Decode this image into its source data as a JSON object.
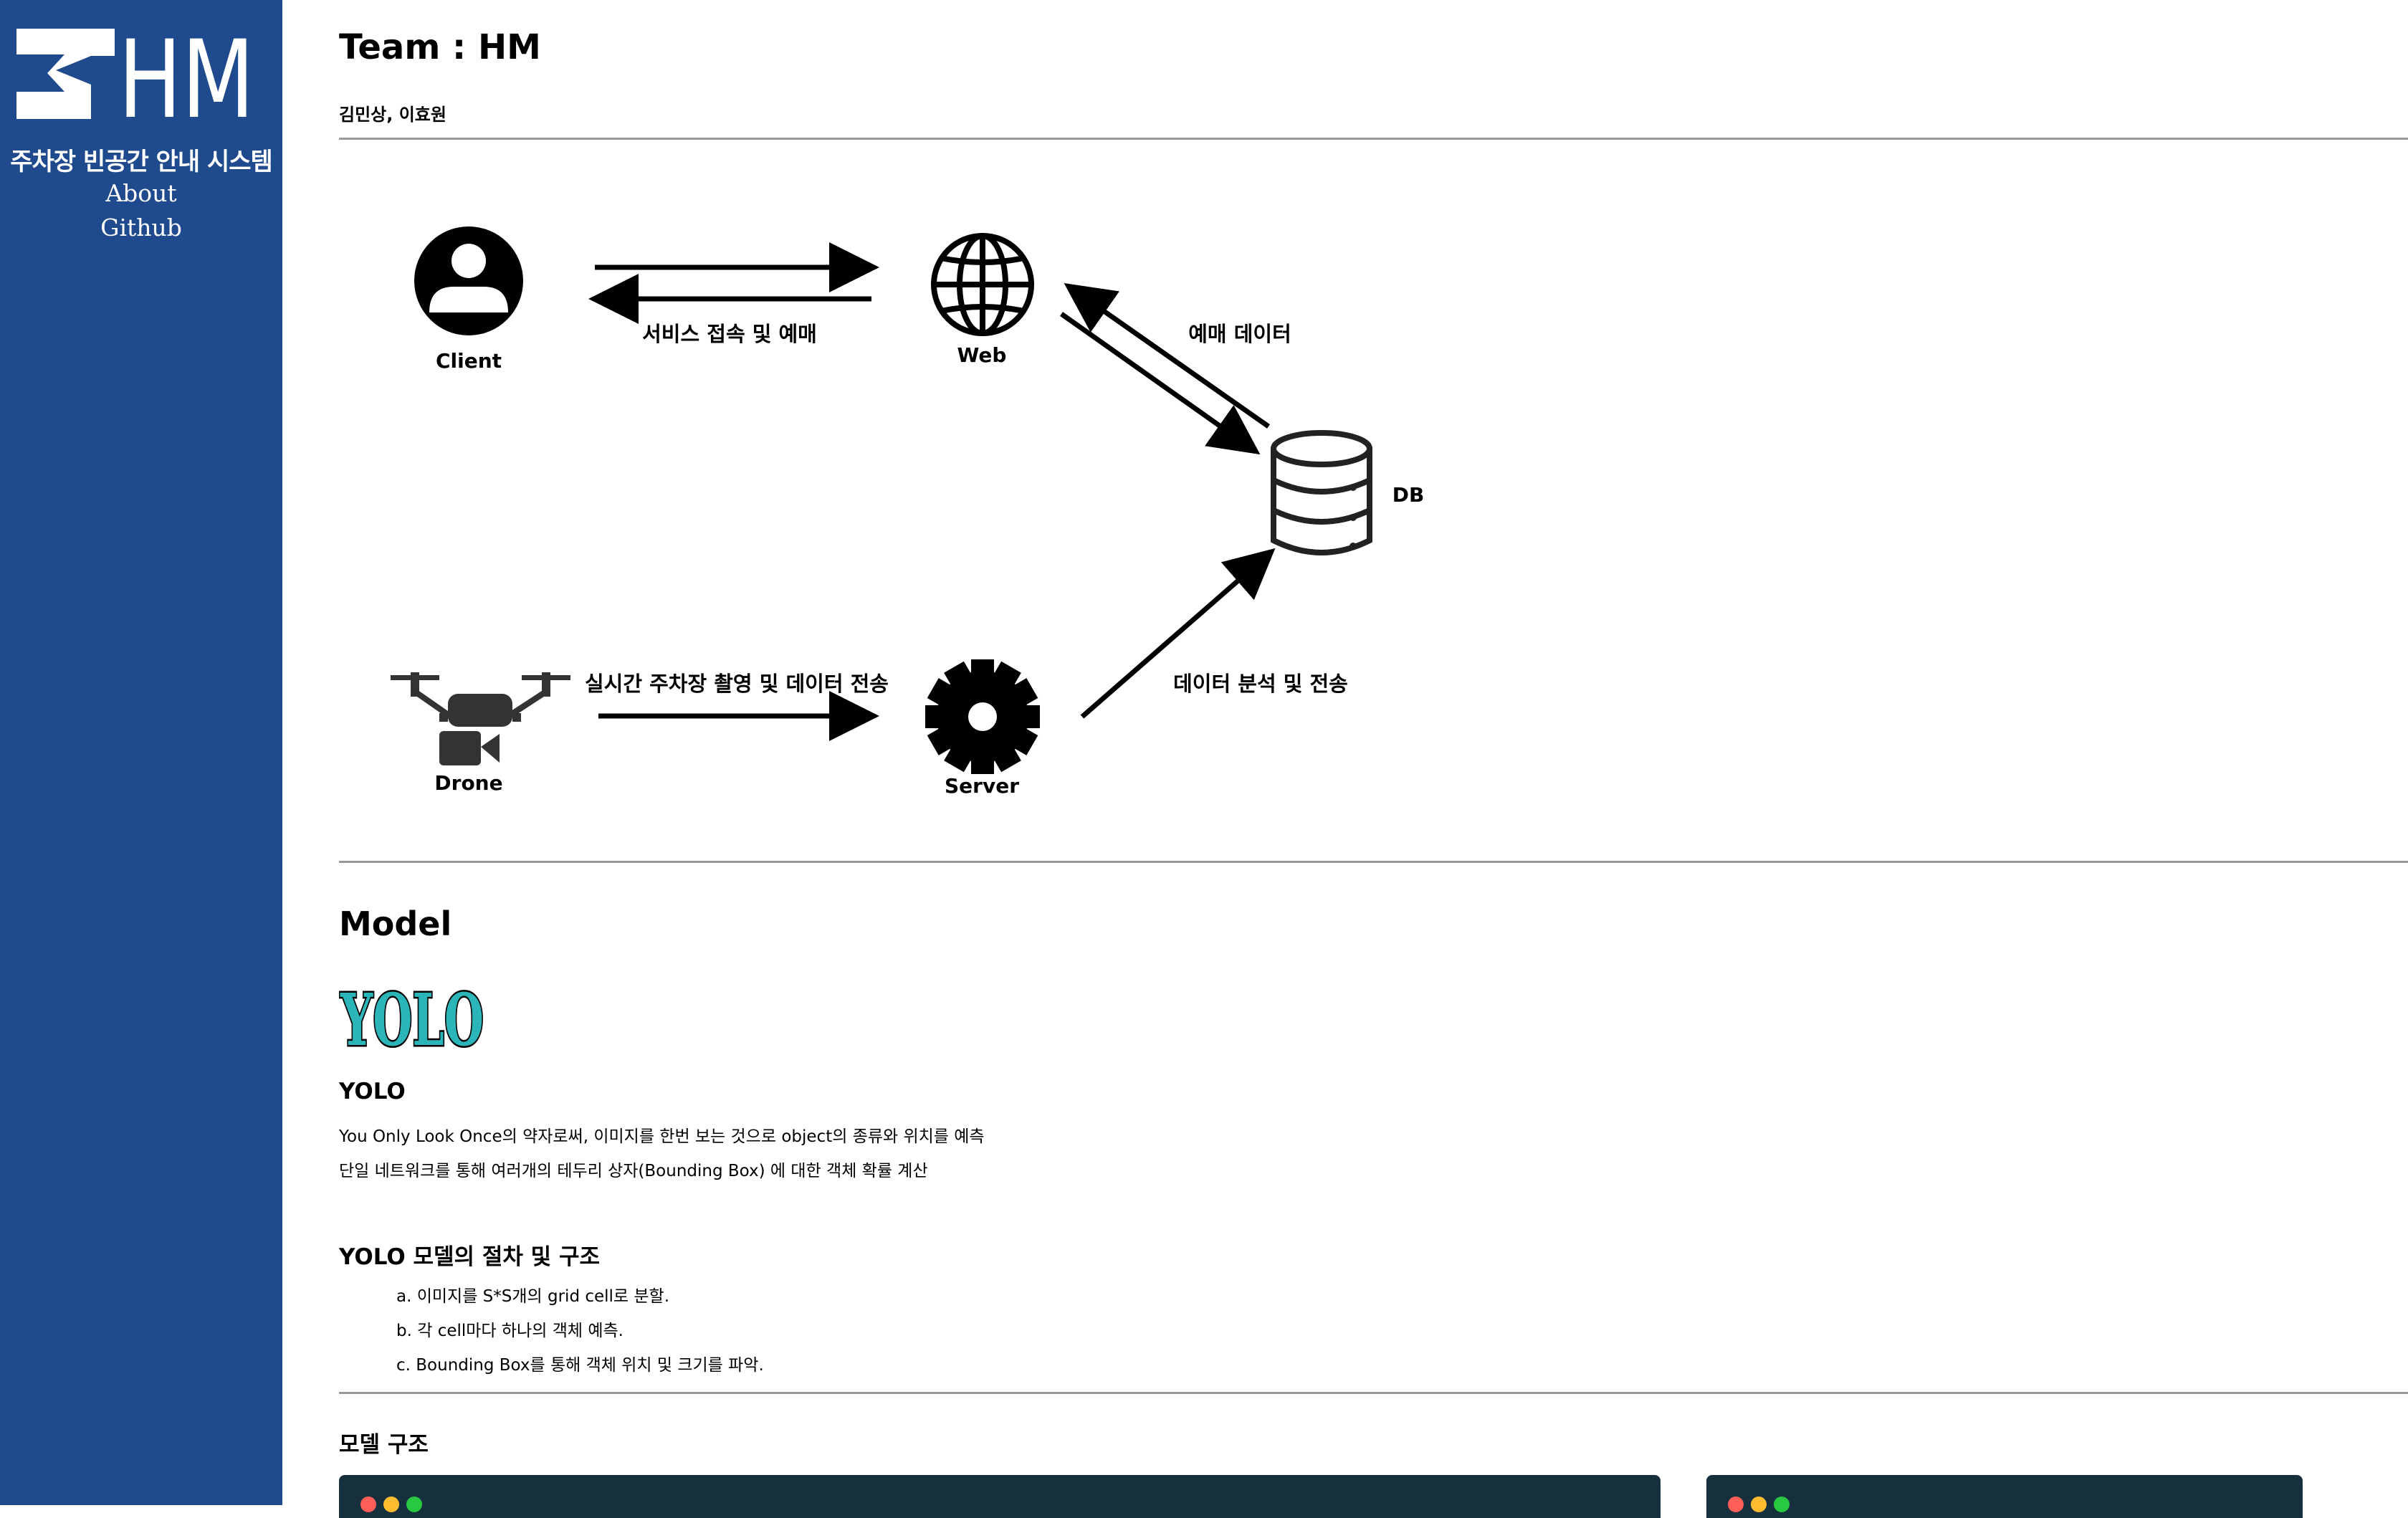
{
  "sidebar": {
    "logo_text": "HM",
    "title": "주차장 빈공간 안내 시스템",
    "links": [
      {
        "label": "About"
      },
      {
        "label": "Github"
      }
    ]
  },
  "header": {
    "title": "Team : HM",
    "members": "김민상, 이효원"
  },
  "diagram": {
    "nodes": {
      "client": "Client",
      "web": "Web",
      "db": "DB",
      "drone": "Drone",
      "server": "Server"
    },
    "edges": {
      "client_web": "서비스 접속 및 예매",
      "web_db": "예매 데이터",
      "drone_server": "실시간 주차장 촬영 및 데이터 전송",
      "server_db": "데이터 분석 및 전송"
    }
  },
  "model": {
    "heading": "Model",
    "logo_text": "YOLO",
    "name": "YOLO",
    "desc": [
      "You Only Look Once의 약자로써, 이미지를 한번 보는 것으로 object의 종류와 위치를 예측",
      "단일 네트워크를 통해 여러개의 테두리 상자(Bounding Box) 에 대한 객체 확률 계산"
    ],
    "procedure_heading": "YOLO 모델의 절차 및 구조",
    "steps": [
      "a. 이미지를 S*S개의 grid cell로 분할.",
      "b. 각 cell마다 하나의 객체 예측.",
      "c. Bounding Box를 통해 객체 위치 및 크기를 파악."
    ],
    "structure_heading": "모델 구조"
  },
  "colors": {
    "sidebar_bg": "#1f4a8e",
    "panel_bg": "#17303d",
    "yolo_teal": "#2bb5b8"
  }
}
